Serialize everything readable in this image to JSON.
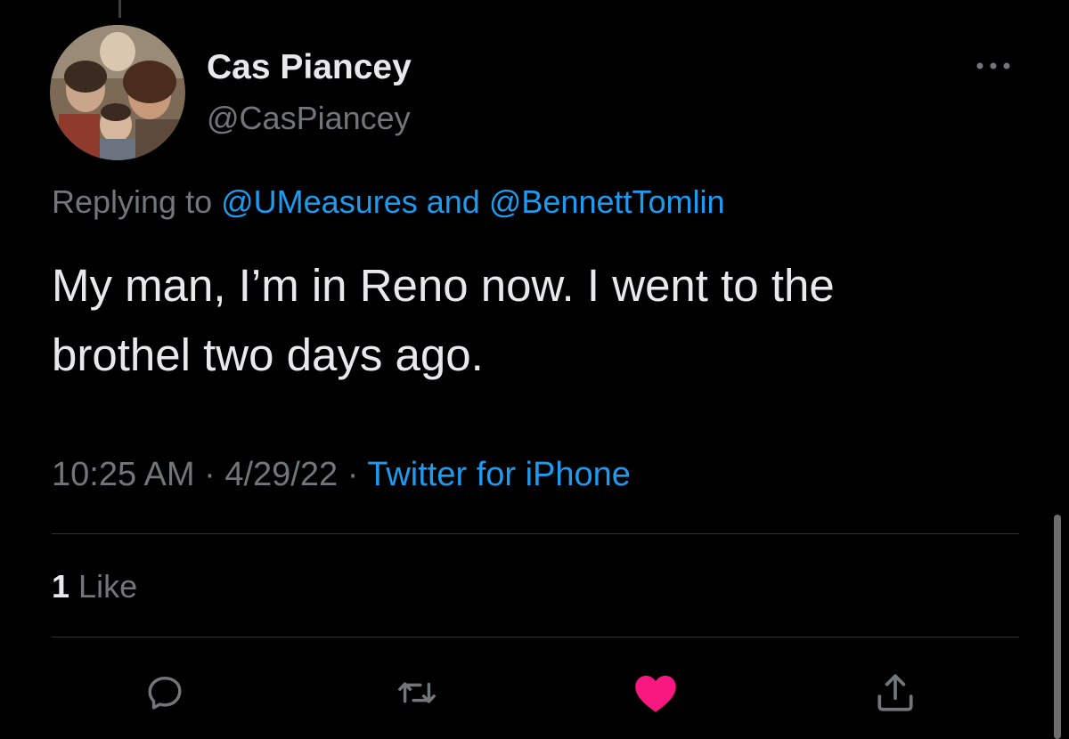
{
  "tweet": {
    "author": {
      "display_name": "Cas Piancey",
      "handle": "@CasPiancey"
    },
    "reply_prefix": "Replying to",
    "reply_mention_1": "@UMeasures",
    "reply_joiner": "and",
    "reply_mention_2": "@BennettTomlin",
    "text_line_1": "My man, I’m in Reno now. I went to the",
    "text_line_2": "brothel two days ago.",
    "time": "10:25 AM",
    "separator_1": "·",
    "date": "4/29/22",
    "separator_2": "·",
    "source": "Twitter for iPhone",
    "likes_count": "1",
    "likes_label": "Like"
  },
  "actions": {
    "reply_icon": "reply-icon",
    "retweet_icon": "retweet-icon",
    "like_icon": "heart-icon",
    "share_icon": "share-icon"
  },
  "colors": {
    "background": "#000000",
    "primary_text": "#e7e9ea",
    "secondary_text": "#71767b",
    "link": "#1d9bf0",
    "like_active": "#f91880",
    "divider": "#2f3336"
  }
}
